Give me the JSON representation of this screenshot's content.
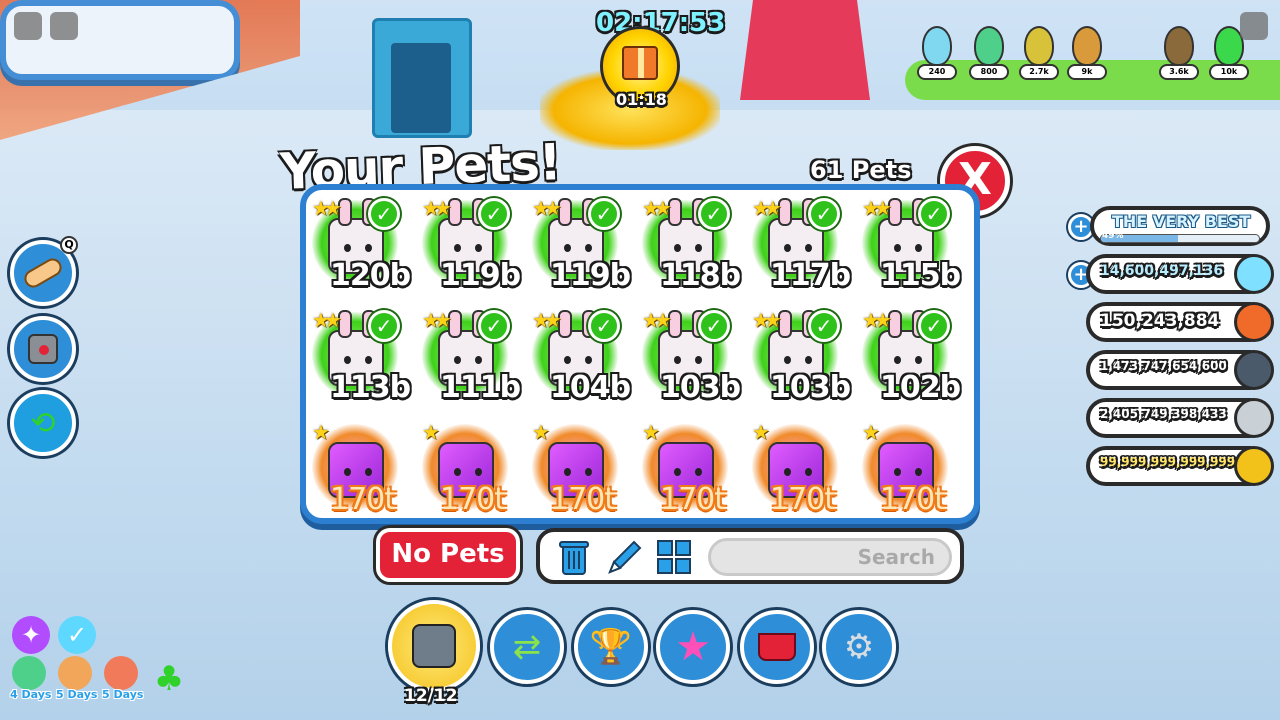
{
  "hud": {
    "event_timer": "02:17:53",
    "gift_timer": "01:18"
  },
  "inventory": {
    "title": "Your Pets!",
    "count_label": "61 Pets",
    "close_label": "X",
    "pets": [
      {
        "value": "120b",
        "kind": "bunny",
        "equipped": true
      },
      {
        "value": "119b",
        "kind": "bunny",
        "equipped": true
      },
      {
        "value": "119b",
        "kind": "bunny",
        "equipped": true
      },
      {
        "value": "118b",
        "kind": "bunny",
        "equipped": true
      },
      {
        "value": "117b",
        "kind": "bunny",
        "equipped": true
      },
      {
        "value": "115b",
        "kind": "bunny",
        "equipped": true
      },
      {
        "value": "113b",
        "kind": "bunny",
        "equipped": true
      },
      {
        "value": "111b",
        "kind": "bunny",
        "equipped": true
      },
      {
        "value": "104b",
        "kind": "bunny",
        "equipped": true
      },
      {
        "value": "103b",
        "kind": "bunny",
        "equipped": true
      },
      {
        "value": "103b",
        "kind": "bunny",
        "equipped": true
      },
      {
        "value": "102b",
        "kind": "bunny",
        "equipped": true
      },
      {
        "value": "170t",
        "kind": "dragon",
        "equipped": false
      },
      {
        "value": "170t",
        "kind": "dragon",
        "equipped": false
      },
      {
        "value": "170t",
        "kind": "dragon",
        "equipped": false
      },
      {
        "value": "170t",
        "kind": "dragon",
        "equipped": false
      },
      {
        "value": "170t",
        "kind": "dragon",
        "equipped": false
      },
      {
        "value": "170t",
        "kind": "dragon",
        "equipped": false
      }
    ],
    "no_pets_label": "No Pets",
    "search_placeholder": "Search",
    "tools": [
      "trash-icon",
      "pencil-icon",
      "grid-icon"
    ]
  },
  "bottom_nav": {
    "pets_count": "12/12",
    "items": [
      "pets-icon",
      "trade-icon",
      "trophy-icon",
      "star-icon",
      "shop-basket-icon",
      "settings-gear-icon"
    ]
  },
  "rank": {
    "name": "THE VERY BEST",
    "progress_label": "49%",
    "progress": 0.49
  },
  "currencies": [
    {
      "value": "14,600,497,136",
      "icon": "diamond-icon",
      "color": "#7fe0ff",
      "has_plus": true
    },
    {
      "value": "150,243,884",
      "icon": "rainbow-coin-icon",
      "color": "#f06a2a",
      "has_plus": false
    },
    {
      "value": "1,473,747,654,600",
      "icon": "paw-coin-icon",
      "color": "#4a5a6a",
      "has_plus": false
    },
    {
      "value": "2,405,749,398,433",
      "icon": "silver-paw-coin-icon",
      "color": "#c9d1d6",
      "has_plus": false
    },
    {
      "value": "99,999,999,999,999",
      "icon": "gold-paw-coin-icon",
      "color": "#f2c21a",
      "has_plus": false
    }
  ],
  "buffs": [
    {
      "label": "4 Days"
    },
    {
      "label": "5 Days"
    },
    {
      "label": "5 Days"
    }
  ],
  "eggs": [
    {
      "price": "240",
      "color": "#7fd8f0"
    },
    {
      "price": "800",
      "color": "#4fd08a"
    },
    {
      "price": "2.7k",
      "color": "#d8c23a"
    },
    {
      "price": "9k",
      "color": "#d89a3a"
    },
    {
      "price": "3.6k",
      "color": "#8a6a3a"
    },
    {
      "price": "10k",
      "color": "#3ad84a"
    }
  ]
}
